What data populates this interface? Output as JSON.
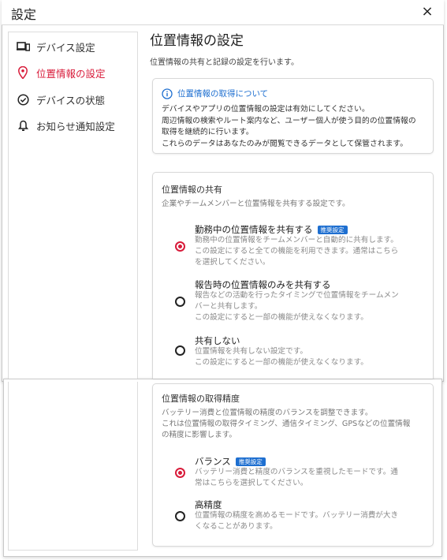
{
  "window": {
    "title": "設定",
    "close_label": "×"
  },
  "sidebar": {
    "items": [
      {
        "label": "デバイス設定",
        "icon": "devices-icon",
        "active": false
      },
      {
        "label": "位置情報の設定",
        "icon": "location-pin-icon",
        "active": true
      },
      {
        "label": "デバイスの状態",
        "icon": "check-circle-icon",
        "active": false
      },
      {
        "label": "お知らせ通知設定",
        "icon": "bell-icon",
        "active": false
      }
    ]
  },
  "main": {
    "title": "位置情報の設定",
    "description": "位置情報の共有と記録の設定を行います。"
  },
  "info": {
    "heading": "位置情報の取得について",
    "lines": [
      "デバイスやアプリの位置情報の設定は有効にしてください。",
      "周辺情報の検索やルート案内など、ユーザー個人が使う目的の位置情報の",
      "取得を継続的に行います。",
      "これらのデータはあなたのみが閲覧できるデータとして保管されます。"
    ]
  },
  "sharing": {
    "title": "位置情報の共有",
    "description": "企業やチームメンバーと位置情報を共有する設定です。",
    "options": [
      {
        "label": "勤務中の位置情報を共有する",
        "badge": "推奨設定",
        "selected": true,
        "desc": [
          "勤務中の位置情報をチームメンバーと自動的に共有します。",
          "この設定にすると全ての機能を利用できます。通常はこちら",
          "を選択してください。"
        ]
      },
      {
        "label": "報告時の位置情報のみを共有する",
        "badge": "",
        "selected": false,
        "desc": [
          "報告などの活動を行ったタイミングで位置情報をチームメン",
          "バーと共有します。",
          "この設定にすると一部の機能が使えなくなります。"
        ]
      },
      {
        "label": "共有しない",
        "badge": "",
        "selected": false,
        "desc": [
          "位置情報を共有しない設定です。",
          "この設定にすると一部の機能が使えなくなります。"
        ]
      }
    ]
  },
  "accuracy": {
    "title": "位置情報の取得精度",
    "description": [
      "バッテリー消費と位置情報の精度のバランスを調整できます。",
      "これは位置情報の取得タイミング、通信タイミング、GPSなどの位置情報",
      "の精度に影響します。"
    ],
    "options": [
      {
        "label": "バランス",
        "badge": "推奨設定",
        "selected": true,
        "desc": [
          "バッテリー消費と精度のバランスを重視したモードです。通",
          "常はこちらを選択してください。"
        ]
      },
      {
        "label": "高精度",
        "badge": "",
        "selected": false,
        "desc": [
          "位置情報の精度を高めるモードです。バッテリー消費が大き",
          "くなることがあります。"
        ]
      }
    ]
  },
  "colors": {
    "accent": "#d81b3a",
    "info_blue": "#1e6fd0",
    "badge_bg": "#1e6fd0"
  }
}
